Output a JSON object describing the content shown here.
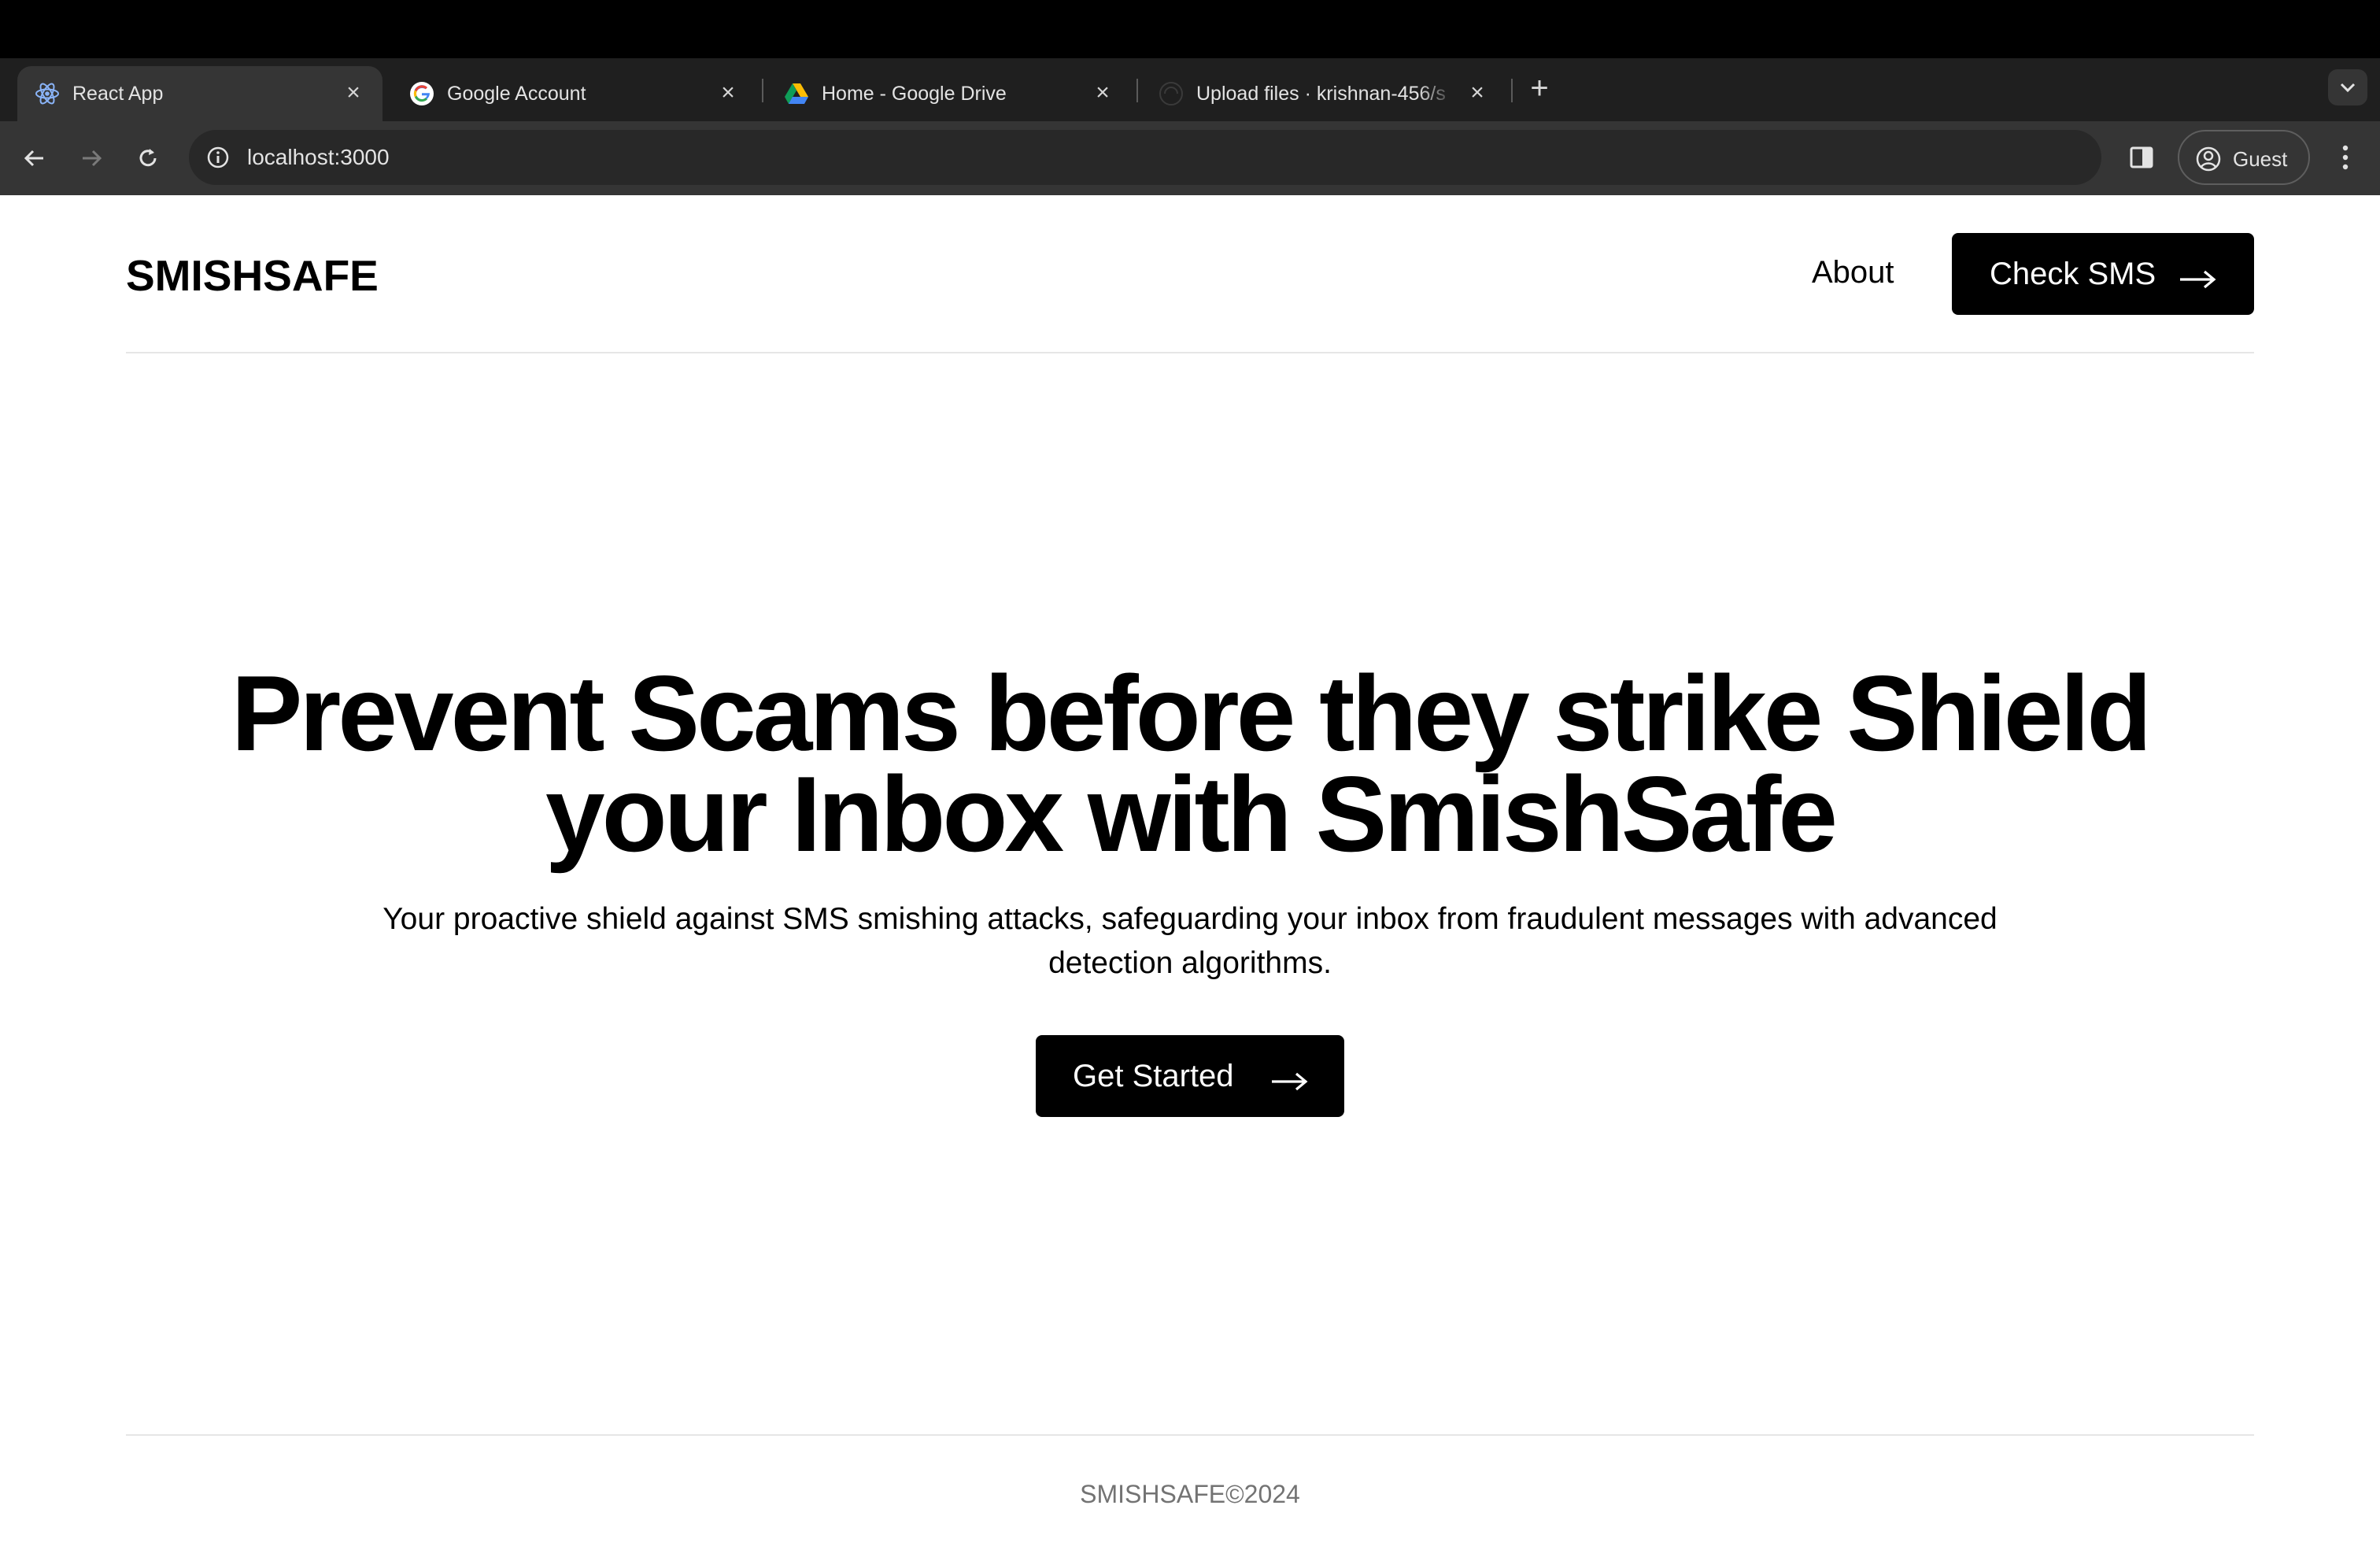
{
  "browser": {
    "tabs": [
      {
        "title": "React App",
        "favicon": "react-icon",
        "active": true
      },
      {
        "title": "Google Account",
        "favicon": "google-icon",
        "active": false
      },
      {
        "title": "Home - Google Drive",
        "favicon": "google-drive-icon",
        "active": false
      },
      {
        "title": "Upload files · krishnan-456/s",
        "favicon": "github-icon",
        "active": false
      }
    ],
    "url": "localhost:3000",
    "profile_label": "Guest"
  },
  "site": {
    "logo": "SMISHSAFE",
    "nav": {
      "about_label": "About",
      "check_sms_label": "Check SMS"
    },
    "hero": {
      "title": "Prevent Scams before they strike Shield your Inbox with SmishSafe",
      "subtitle": "Your proactive shield against SMS smishing attacks, safeguarding your inbox from fraudulent messages with advanced detection algorithms.",
      "cta_label": "Get Started"
    },
    "footer": {
      "text": "SMISHSAFE©2024"
    }
  },
  "colors": {
    "primary": "#000000",
    "background": "#ffffff",
    "footer_text": "#737373",
    "chrome_dark": "#1f1f1f",
    "chrome_toolbar": "#353535"
  }
}
